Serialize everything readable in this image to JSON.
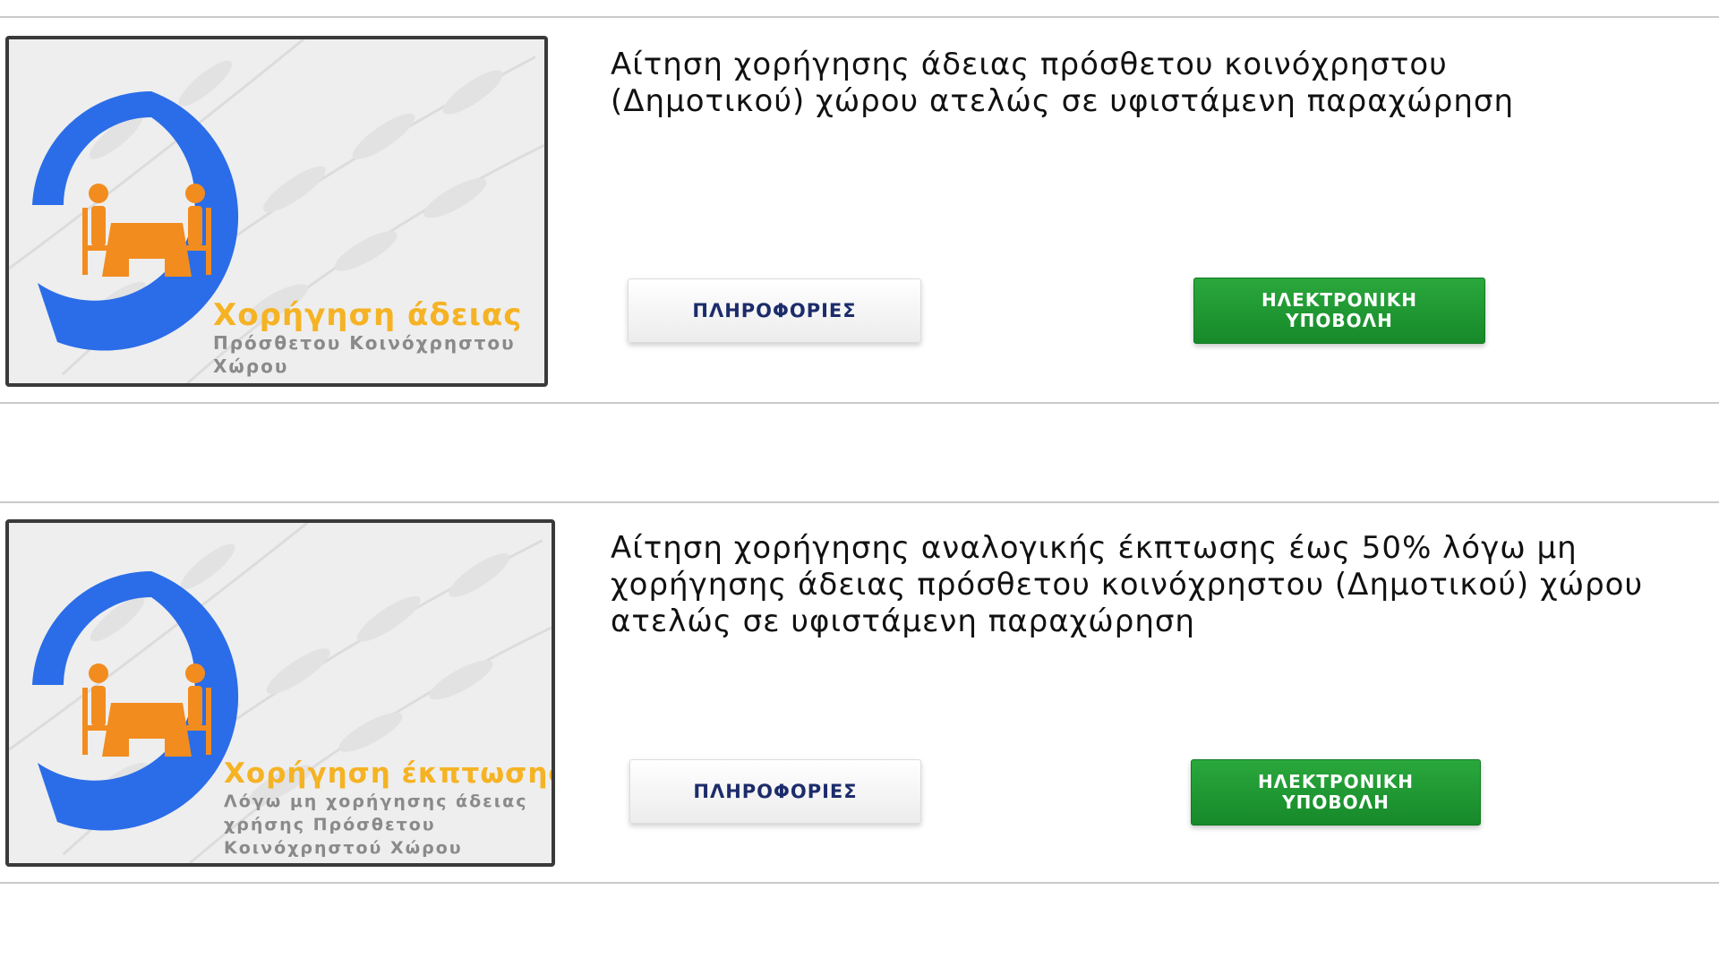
{
  "colors": {
    "pin_blue": "#2b6de8",
    "figure_orange": "#f28c1e",
    "caption_yellow": "#f5b324",
    "caption_gray": "#8a8a8a",
    "submit_green": "#1f9a32",
    "info_text": "#1c2c6b"
  },
  "services": [
    {
      "title": "Αίτηση χορήγησης άδειας πρόσθετου κοινόχρηστου (Δημοτικού) χώρου ατελώς σε υφιστάμενη παραχώρηση",
      "thumbnail": {
        "icon": "table-and-chairs-pin-icon",
        "caption_title": "Χορήγηση άδειας",
        "caption_subtitle": "Πρόσθετου Κοινόχρηστου Χώρου"
      },
      "info_label": "ΠΛΗΡΟΦΟΡΙΕΣ",
      "submit_label_line1": "ΗΛΕΚΤΡΟΝΙΚΗ",
      "submit_label_line2": "ΥΠΟΒΟΛΗ"
    },
    {
      "title": "Αίτηση χορήγησης αναλογικής έκπτωσης έως 50% λόγω μη χορήγησης άδειας πρόσθετου κοινόχρηστου (Δημοτικού) χώρου ατελώς σε υφιστάμενη παραχώρηση",
      "thumbnail": {
        "icon": "table-and-chairs-pin-icon",
        "caption_title": "Χορήγηση έκπτωσης",
        "caption_subtitle": "Λόγω μη χορήγησης άδειας χρήσης Πρόσθετου Κοινόχρηστού Χώρου"
      },
      "info_label": "ΠΛΗΡΟΦΟΡΙΕΣ",
      "submit_label_line1": "ΗΛΕΚΤΡΟΝΙΚΗ",
      "submit_label_line2": "ΥΠΟΒΟΛΗ"
    }
  ]
}
